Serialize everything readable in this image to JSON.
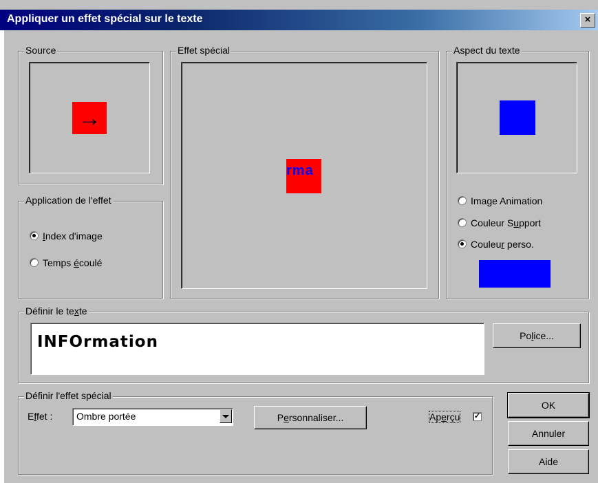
{
  "window": {
    "title": "Appliquer un effet spécial sur le texte",
    "close_glyph": "×"
  },
  "source": {
    "legend": "Source",
    "arrow_glyph": "→",
    "swatch_color": "#ff0000"
  },
  "special_effect": {
    "legend": "Effet spécial",
    "preview_fragment": "rma",
    "swatch_color": "#ff0000",
    "text_color": "#0000ff"
  },
  "text_aspect": {
    "legend": "Aspect du texte",
    "swatch_color": "#0000ff",
    "options": [
      {
        "pre": "Ima",
        "key": "g",
        "post": "e Animation",
        "selected": false
      },
      {
        "pre": "Couleur S",
        "key": "u",
        "post": "pport",
        "selected": false
      },
      {
        "pre": "Couleu",
        "key": "r",
        "post": " perso.",
        "selected": true
      }
    ],
    "custom_color": "#0000ff"
  },
  "application": {
    "legend": "Application de l'effet",
    "options": [
      {
        "pre": "",
        "key": "I",
        "post": "ndex d'image",
        "selected": true
      },
      {
        "pre": "Temps ",
        "key": "é",
        "post": "coulé",
        "selected": false
      }
    ]
  },
  "define_text": {
    "legend_pre": "Définir le te",
    "legend_key": "x",
    "legend_post": "te",
    "value": "INFOrmation",
    "font_button_pre": "Po",
    "font_button_key": "l",
    "font_button_post": "ice..."
  },
  "define_effect": {
    "legend": "Définir l'effet spécial",
    "effect_label_pre": "E",
    "effect_label_key": "f",
    "effect_label_post": "fet :",
    "effect_value": "Ombre portée",
    "customize_pre": "P",
    "customize_key": "e",
    "customize_post": "rsonnaliser...",
    "preview_pre": "Ap",
    "preview_key": "e",
    "preview_post": "rçu",
    "preview_checked": true
  },
  "buttons": {
    "ok": "OK",
    "cancel": "Annuler",
    "help": "Aide"
  }
}
